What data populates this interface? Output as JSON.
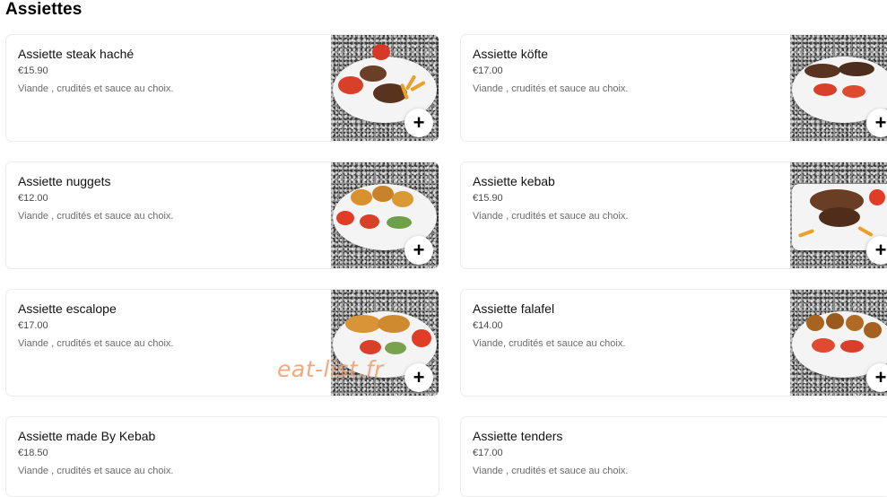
{
  "section": {
    "title": "Assiettes"
  },
  "watermark": "eat-list.fr",
  "items": [
    {
      "name": "Assiette steak haché",
      "price": "€15.90",
      "desc": "Viande , crudités et sauce au choix."
    },
    {
      "name": "Assiette köfte",
      "price": "€17.00",
      "desc": "Viande , crudités et sauce au choix."
    },
    {
      "name": "Assiette nuggets",
      "price": "€12.00",
      "desc": "Viande , crudités et sauce au choix."
    },
    {
      "name": "Assiette kebab",
      "price": "€15.90",
      "desc": "Viande , crudités et sauce au choix."
    },
    {
      "name": "Assiette escalope",
      "price": "€17.00",
      "desc": "Viande , crudités et sauce au choix."
    },
    {
      "name": "Assiette falafel",
      "price": "€14.00",
      "desc": "Viande, crudités et sauce au choix."
    },
    {
      "name": "Assiette made By Kebab",
      "price": "€18.50",
      "desc": "Viande , crudités et sauce au choix."
    },
    {
      "name": "Assiette tenders",
      "price": "€17.00",
      "desc": "Viande , crudités et sauce au choix."
    }
  ],
  "add_button_label": "+",
  "icons": {
    "add": "plus-icon"
  }
}
